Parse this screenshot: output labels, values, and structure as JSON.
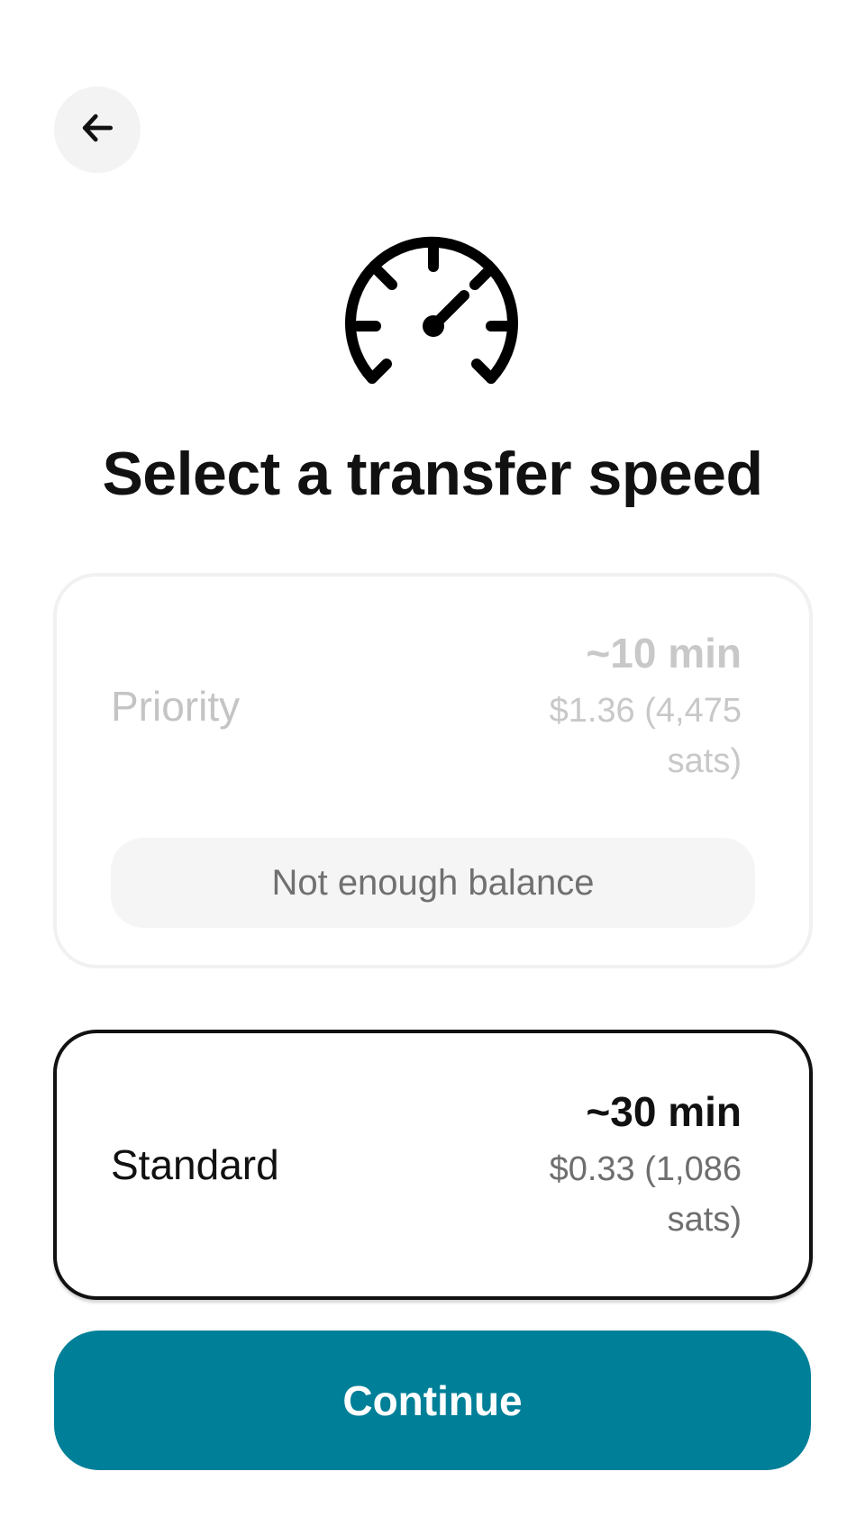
{
  "header": {
    "back_icon": "arrow-left-icon"
  },
  "hero": {
    "icon": "speedometer-icon",
    "title": "Select a transfer speed"
  },
  "options": [
    {
      "label": "Priority",
      "time": "~10 min",
      "fee": "$1.36 (4,475 sats)",
      "disabled": true,
      "notice": "Not enough balance"
    },
    {
      "label": "Standard",
      "time": "~30 min",
      "fee": "$0.33 (1,086 sats)",
      "selected": true
    }
  ],
  "footer": {
    "continue_label": "Continue"
  },
  "colors": {
    "accent": "#007f98",
    "selected_border": "#111111",
    "disabled_text": "#c4c4c4"
  }
}
